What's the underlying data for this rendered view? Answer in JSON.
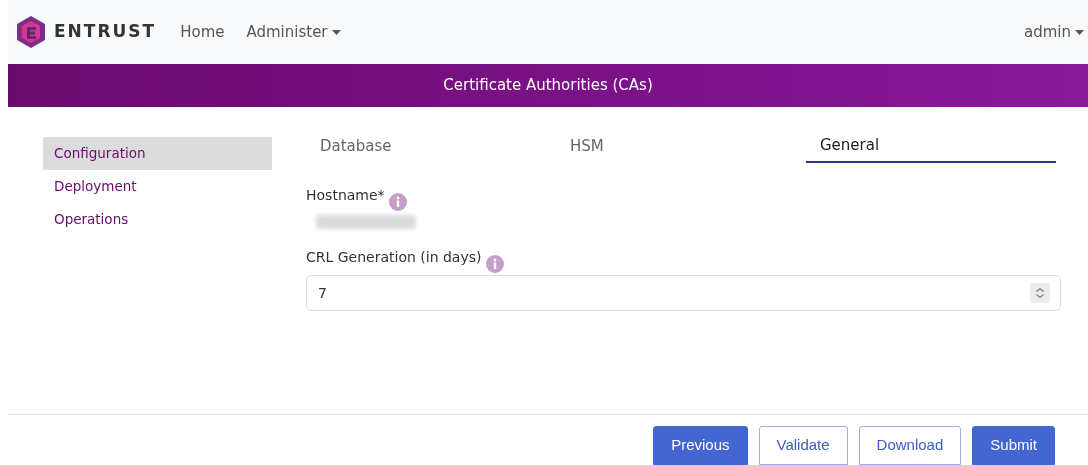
{
  "navbar": {
    "brand": "ENTRUST",
    "links": [
      {
        "label": "Home",
        "dropdown": false
      },
      {
        "label": "Administer",
        "dropdown": true
      }
    ],
    "user": "admin"
  },
  "banner": {
    "title": "Certificate Authorities (CAs)"
  },
  "sidebar": {
    "items": [
      {
        "label": "Configuration",
        "selected": true
      },
      {
        "label": "Deployment",
        "selected": false
      },
      {
        "label": "Operations",
        "selected": false
      }
    ]
  },
  "tabs": [
    {
      "label": "Database",
      "selected": false
    },
    {
      "label": "HSM",
      "selected": false
    },
    {
      "label": "General",
      "selected": true
    }
  ],
  "fields": [
    {
      "kind": "readonly",
      "label": "Hostname*"
    },
    {
      "kind": "number",
      "label": "CRL Generation (in days)",
      "value": "7"
    }
  ],
  "buttons": [
    {
      "label": "Previous",
      "kind": "primary"
    },
    {
      "label": "Validate",
      "kind": "outline"
    },
    {
      "label": "Download",
      "kind": "outline"
    },
    {
      "label": "Submit",
      "kind": "primary"
    }
  ]
}
